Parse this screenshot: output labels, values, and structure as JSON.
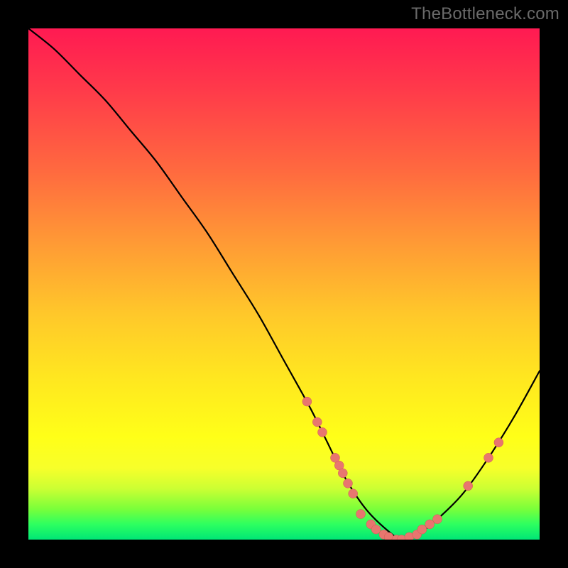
{
  "watermark": "TheBottleneck.com",
  "chart_data": {
    "type": "line",
    "title": "",
    "xlabel": "",
    "ylabel": "",
    "xlim": [
      0,
      100
    ],
    "ylim": [
      0,
      100
    ],
    "grid": false,
    "legend": false,
    "series": [
      {
        "name": "curve",
        "x": [
          0,
          5,
          10,
          15,
          20,
          25,
          30,
          35,
          40,
          45,
          50,
          55,
          58,
          62,
          66,
          70,
          73,
          76,
          80,
          85,
          90,
          95,
          100
        ],
        "y": [
          100,
          96,
          91,
          86,
          80,
          74,
          67,
          60,
          52,
          44,
          35,
          26,
          20,
          12,
          6,
          2,
          0,
          1,
          4,
          9,
          16,
          24,
          33
        ]
      }
    ],
    "markers": [
      {
        "x": 54.5,
        "y": 27
      },
      {
        "x": 56.5,
        "y": 23
      },
      {
        "x": 57.5,
        "y": 21
      },
      {
        "x": 60,
        "y": 16
      },
      {
        "x": 60.8,
        "y": 14.5
      },
      {
        "x": 61.5,
        "y": 13
      },
      {
        "x": 62.5,
        "y": 11
      },
      {
        "x": 63.5,
        "y": 9
      },
      {
        "x": 65,
        "y": 5
      },
      {
        "x": 67,
        "y": 3
      },
      {
        "x": 68,
        "y": 2
      },
      {
        "x": 69.5,
        "y": 1
      },
      {
        "x": 70.5,
        "y": 0.5
      },
      {
        "x": 72,
        "y": 0
      },
      {
        "x": 73,
        "y": 0
      },
      {
        "x": 74.5,
        "y": 0.5
      },
      {
        "x": 76,
        "y": 1
      },
      {
        "x": 77,
        "y": 2
      },
      {
        "x": 78.5,
        "y": 3
      },
      {
        "x": 80,
        "y": 4
      },
      {
        "x": 86,
        "y": 10.5
      },
      {
        "x": 90,
        "y": 16
      },
      {
        "x": 92,
        "y": 19
      }
    ],
    "colors": {
      "line": "#000000",
      "marker_fill": "#e8766f",
      "marker_stroke": "#d15a54"
    }
  }
}
